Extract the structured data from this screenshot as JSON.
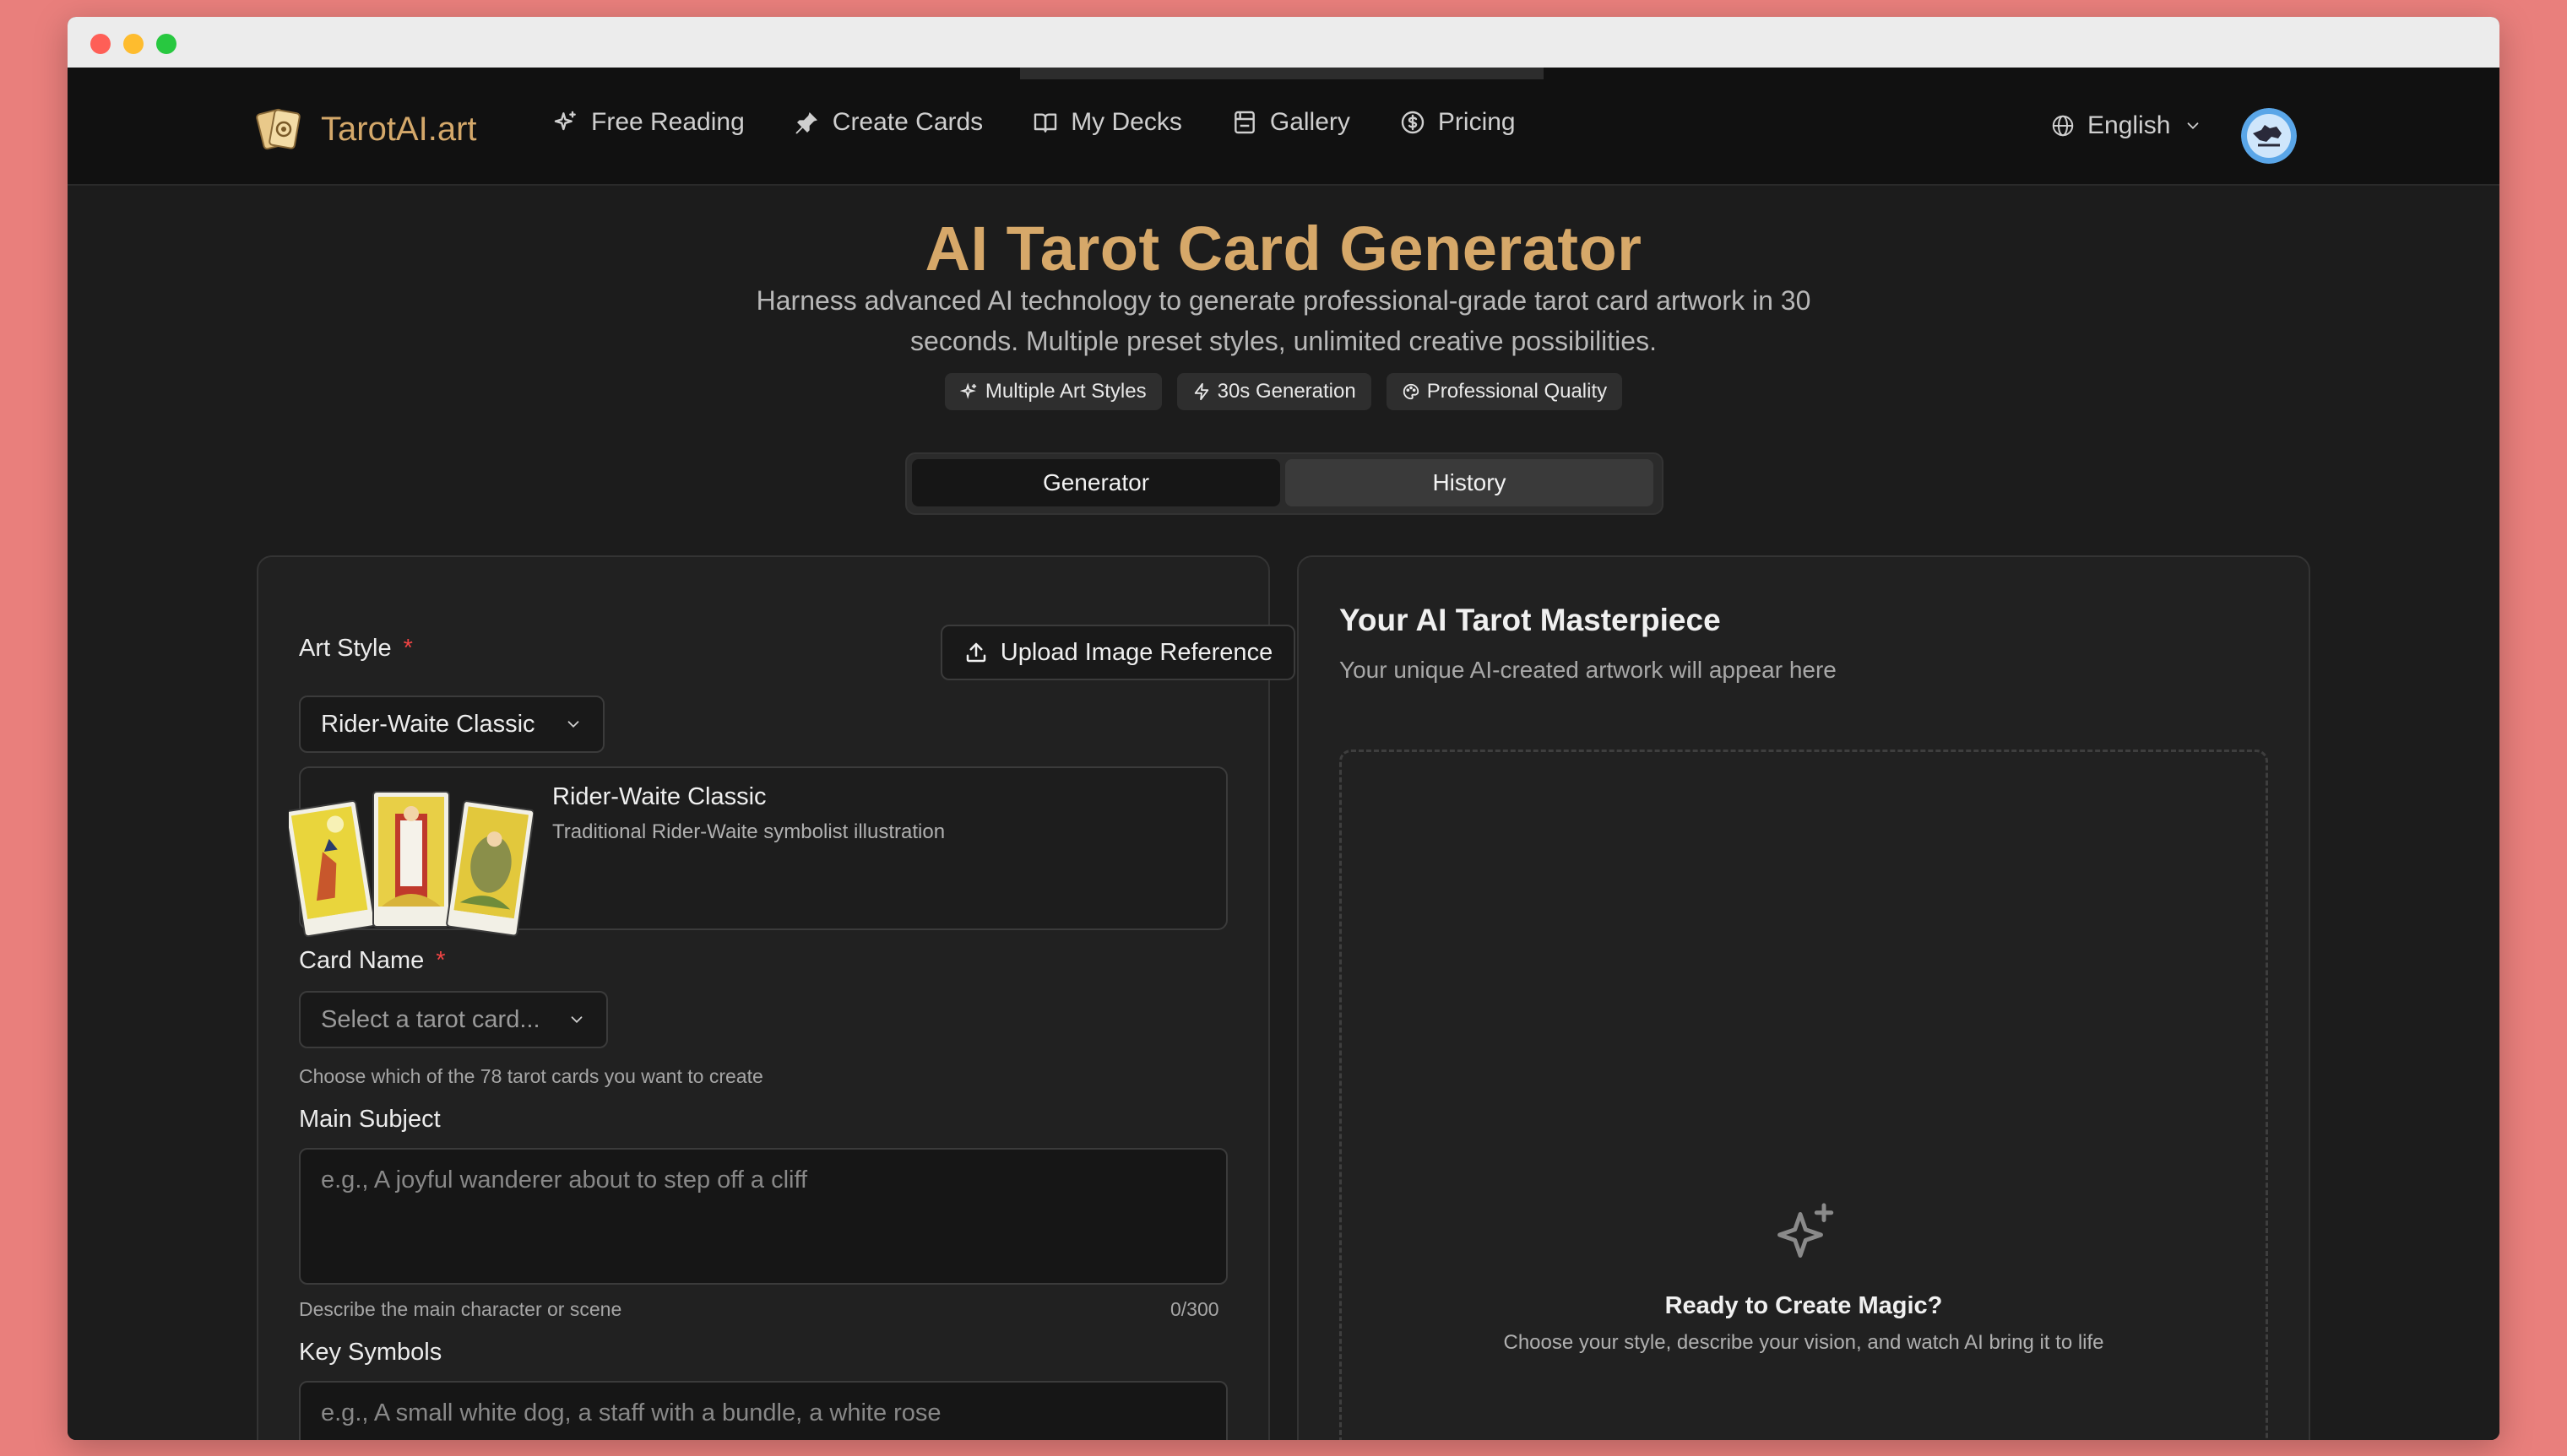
{
  "nav": {
    "brand": "TarotAI.art",
    "items": [
      {
        "label": "Free Reading",
        "icon": "sparkles-icon"
      },
      {
        "label": "Create Cards",
        "icon": "pin-icon"
      },
      {
        "label": "My Decks",
        "icon": "book-icon"
      },
      {
        "label": "Gallery",
        "icon": "gallery-icon"
      },
      {
        "label": "Pricing",
        "icon": "dollar-circle-icon"
      }
    ],
    "language": "English"
  },
  "hero": {
    "title": "AI Tarot Card Generator",
    "subtitle": "Harness advanced AI technology to generate professional-grade tarot card artwork in 30 seconds. Multiple preset styles, unlimited creative possibilities.",
    "chips": [
      "Multiple Art Styles",
      "30s Generation",
      "Professional Quality"
    ]
  },
  "tabs": {
    "active": "Generator",
    "items": [
      "Generator",
      "History"
    ]
  },
  "form": {
    "art_style_label": "Art Style",
    "required_mark": "*",
    "upload_label": "Upload Image Reference",
    "art_style_value": "Rider-Waite Classic",
    "style_card": {
      "name": "Rider-Waite Classic",
      "description": "Traditional Rider-Waite symbolist illustration"
    },
    "card_name_label": "Card Name",
    "card_name_placeholder": "Select a tarot card...",
    "card_name_helper": "Choose which of the 78 tarot cards you want to create",
    "main_subject_label": "Main Subject",
    "main_subject_placeholder": "e.g., A joyful wanderer about to step off a cliff",
    "main_subject_helper": "Describe the main character or scene",
    "main_subject_count": "0/300",
    "key_symbols_label": "Key Symbols",
    "key_symbols_placeholder": "e.g., A small white dog, a staff with a bundle, a white rose"
  },
  "result": {
    "title": "Your AI Tarot Masterpiece",
    "subtitle": "Your unique AI-created artwork will appear here",
    "empty_title": "Ready to Create Magic?",
    "empty_subtitle": "Choose your style, describe your vision, and watch AI bring it to life"
  },
  "colors": {
    "accent": "#d6a869",
    "background": "#1c1c1c",
    "required": "#ef4444"
  }
}
